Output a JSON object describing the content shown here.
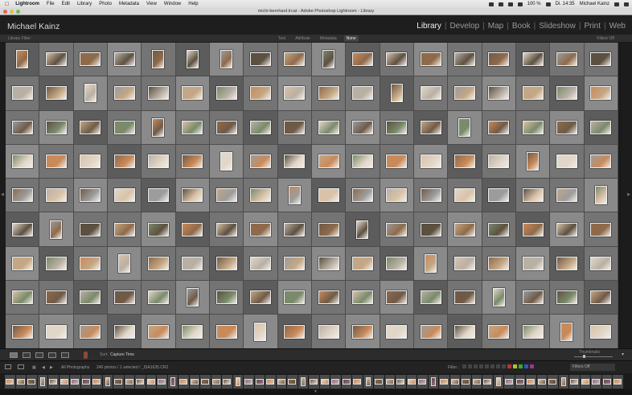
{
  "menubar": {
    "items": [
      "Lightroom",
      "File",
      "Edit",
      "Library",
      "Photo",
      "Metadata",
      "View",
      "Window",
      "Help"
    ],
    "right": {
      "battery": "100 %",
      "clock": "Di. 14:35",
      "user": "Michael Kainz"
    }
  },
  "window": {
    "title": "michi-bernhard.lrcat - Adobe Photoshop Lightroom - Library"
  },
  "identity": {
    "name": "Michael Kainz"
  },
  "modules": {
    "items": [
      "Library",
      "Develop",
      "Map",
      "Book",
      "Slideshow",
      "Print",
      "Web"
    ],
    "active": "Library"
  },
  "filter_bar": {
    "label": "Library Filter :",
    "tabs": [
      "Text",
      "Attribute",
      "Metadata",
      "None"
    ],
    "active_tab": "None",
    "filters_off": "Filters Off"
  },
  "toolbar": {
    "sort_label": "Sort:",
    "sort_value": "Capture Time",
    "thumbnails_label": "Thumbnails"
  },
  "filmstrip_header": {
    "source": "All Photographs",
    "count": "246 photos / 1 selected / _ISA1635.CR2",
    "filter_label": "Filter :",
    "filter_value": "Filters Off"
  },
  "colors": {
    "grid_light": "#8a8a8a",
    "grid_mid": "#747474",
    "grid_dark": "#5c5c5c",
    "accent": "#f0f0f0"
  },
  "grid": {
    "columns": 18,
    "rows": 9
  }
}
